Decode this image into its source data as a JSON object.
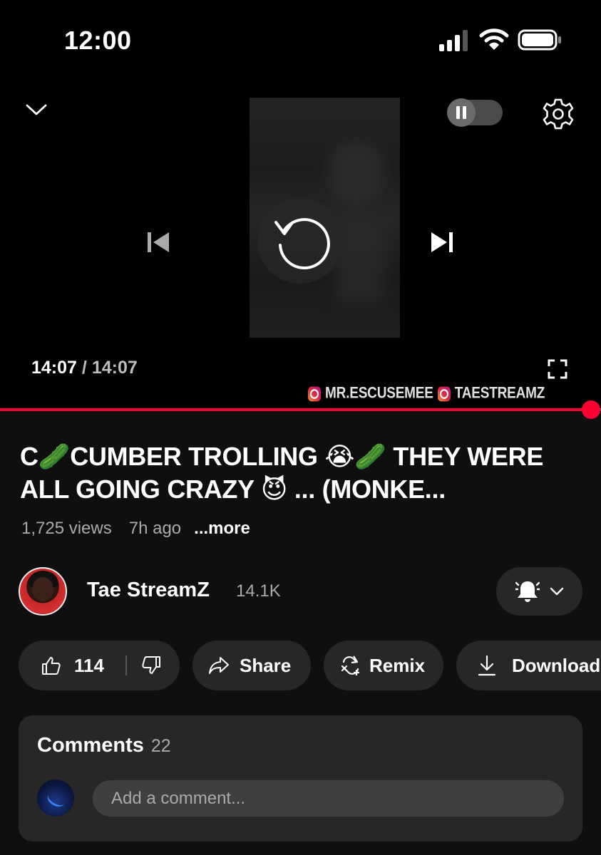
{
  "status_bar": {
    "time": "12:00",
    "icons": [
      "cellular-signal-icon",
      "wifi-icon",
      "battery-icon"
    ]
  },
  "player": {
    "icons": {
      "collapse": "chevron-down-icon",
      "autoplay": "pause-icon",
      "settings": "gear-icon",
      "previous": "skip-previous-icon",
      "replay": "replay-icon",
      "next": "skip-next-icon",
      "fullscreen": "fullscreen-icon"
    },
    "current_time": "14:07",
    "separator": "/",
    "duration": "14:07",
    "progress": 1.0,
    "watermark_handles": [
      "MR.ESCUSEMEE",
      "TAESTREAMZ"
    ],
    "accent_color": "#ff0033"
  },
  "video": {
    "title": "C🥒CUMBER TROLLING 😭🥒 THEY WERE ALL GOING CRAZY 😈 ... (MONKE...",
    "views": "1,725 views",
    "ago": "7h ago",
    "more_label": "...more"
  },
  "channel": {
    "name": "Tae StreamZ",
    "subscribers": "14.1K",
    "bell_icon": "bell-icon",
    "dropdown_icon": "chevron-down-icon"
  },
  "actions": {
    "like_count": "114",
    "share_label": "Share",
    "remix_label": "Remix",
    "download_label": "Download"
  },
  "comments": {
    "heading": "Comments",
    "count": "22",
    "placeholder": "Add a comment..."
  },
  "colors": {
    "background": "#0f0f0f",
    "surface": "#272727",
    "secondary_text": "#aaaaaa"
  }
}
